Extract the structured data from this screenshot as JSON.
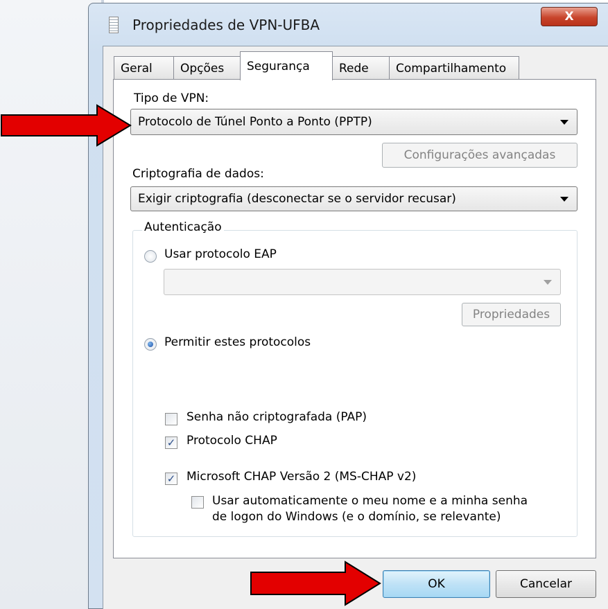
{
  "window": {
    "title": "Propriedades de VPN-UFBA",
    "close_glyph": "X"
  },
  "tabs": [
    {
      "label": "Geral"
    },
    {
      "label": "Opções"
    },
    {
      "label": "Segurança",
      "active": true
    },
    {
      "label": "Rede"
    },
    {
      "label": "Compartilhamento"
    }
  ],
  "vpn_type": {
    "label": "Tipo de VPN:",
    "selected": "Protocolo de Túnel Ponto a Ponto (PPTP)",
    "advanced_button": "Configurações avançadas"
  },
  "encryption": {
    "label": "Criptografia de dados:",
    "selected": "Exigir criptografia (desconectar se o servidor recusar)"
  },
  "authentication": {
    "legend": "Autenticação",
    "eap_radio": {
      "label": "Usar protocolo EAP",
      "checked": false
    },
    "eap_combo": {
      "selected": ""
    },
    "properties_button": "Propriedades",
    "allow_radio": {
      "label": "Permitir estes protocolos",
      "checked": true
    },
    "protocols": [
      {
        "label": "Senha não criptografada (PAP)",
        "checked": false
      },
      {
        "label": "Protocolo CHAP",
        "checked": true
      },
      {
        "label": "Microsoft CHAP Versão 2 (MS-CHAP v2)",
        "checked": true
      }
    ],
    "auto_logon": {
      "line1": "Usar automaticamente o meu nome e a minha senha",
      "line2": "de logon do Windows (e o domínio, se relevante)",
      "checked": false
    }
  },
  "footer": {
    "ok_label": "OK",
    "cancel_label": "Cancelar"
  },
  "colors": {
    "annotation_arrow": "#e30000",
    "dialog_frame": "#cfdff0",
    "default_button": "#a7d8f4"
  }
}
